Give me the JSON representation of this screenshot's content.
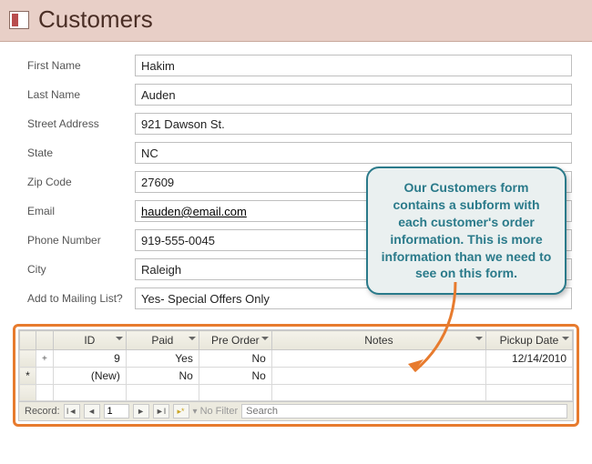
{
  "header": {
    "title": "Customers"
  },
  "form": {
    "labels": {
      "first_name": "First Name",
      "last_name": "Last Name",
      "street": "Street Address",
      "state": "State",
      "zip": "Zip Code",
      "email": "Email",
      "phone": "Phone Number",
      "city": "City",
      "mailing": "Add to Mailing List?"
    },
    "values": {
      "first_name": "Hakim",
      "last_name": "Auden",
      "street": "921 Dawson St.",
      "state": "NC",
      "zip": "27609",
      "email": "hauden@email.com",
      "phone": "919-555-0045",
      "city": "Raleigh",
      "mailing": "Yes- Special Offers Only"
    }
  },
  "subform": {
    "columns": [
      "ID",
      "Paid",
      "Pre Order",
      "Notes",
      "Pickup Date"
    ],
    "rows": [
      {
        "marker": "",
        "expand": "+",
        "id": "9",
        "paid": "Yes",
        "preorder": "No",
        "notes": "",
        "pickup": "12/14/2010"
      },
      {
        "marker": "*",
        "expand": "",
        "id": "(New)",
        "paid": "No",
        "preorder": "No",
        "notes": "",
        "pickup": ""
      }
    ],
    "nav": {
      "label": "Record:",
      "current": "1",
      "filter": "No Filter",
      "search_placeholder": "Search"
    }
  },
  "callout": {
    "text": "Our Customers form contains a subform with each customer's order information. This is more information than we need to see on this form."
  }
}
